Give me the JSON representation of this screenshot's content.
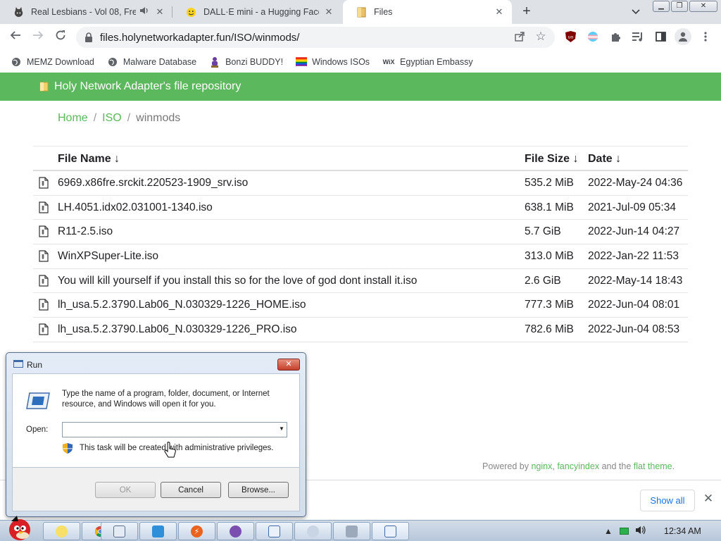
{
  "browser": {
    "tabs": [
      {
        "title": "Real Lesbians - Vol 08, Fre",
        "favicon": "cat-face-icon",
        "audio": true
      },
      {
        "title": "DALL·E mini - a Hugging Face",
        "favicon": "hugging-face-icon"
      },
      {
        "title": "Files",
        "favicon": "folder-icon",
        "active": true
      }
    ],
    "url": "files.holynetworkadapter.fun/ISO/winmods/"
  },
  "bookmarks": [
    {
      "label": "MEMZ Download",
      "icon": "globe-icon"
    },
    {
      "label": "Malware Database",
      "icon": "globe-icon"
    },
    {
      "label": "Bonzi BUDDY!",
      "icon": "bonzi-icon"
    },
    {
      "label": "Windows ISOs",
      "icon": "rainbow-flag-icon"
    },
    {
      "label": "Egyptian Embassy",
      "icon": "wix-icon"
    }
  ],
  "page": {
    "header_title": "Holy Network Adapter's file repository",
    "breadcrumbs": {
      "home": "Home",
      "sep1": "/",
      "iso": "ISO",
      "sep2": "/",
      "current": "winmods"
    },
    "columns": {
      "name": "File Name  ↓",
      "size": "File Size  ↓",
      "date": "Date  ↓"
    },
    "files": [
      {
        "name": "6969.x86fre.srckit.220523-1909_srv.iso",
        "size": "535.2 MiB",
        "date": "2022-May-24 04:36"
      },
      {
        "name": "LH.4051.idx02.031001-1340.iso",
        "size": "638.1 MiB",
        "date": "2021-Jul-09 05:34"
      },
      {
        "name": "R11-2.5.iso",
        "size": "5.7 GiB",
        "date": "2022-Jun-14 04:27"
      },
      {
        "name": "WinXPSuper-Lite.iso",
        "size": "313.0 MiB",
        "date": "2022-Jan-22 11:53"
      },
      {
        "name": "You will kill yourself if you install this so for the love of god dont install it.iso",
        "size": "2.6 GiB",
        "date": "2022-May-14 18:43"
      },
      {
        "name": "lh_usa.5.2.3790.Lab06_N.030329-1226_HOME.iso",
        "size": "777.3 MiB",
        "date": "2022-Jun-04 08:01"
      },
      {
        "name": "lh_usa.5.2.3790.Lab06_N.030329-1226_PRO.iso",
        "size": "782.6 MiB",
        "date": "2022-Jun-04 08:53"
      }
    ],
    "footer": {
      "prefix": "Powered by ",
      "nginx": "nginx",
      "comma": ", ",
      "fancyindex": "fancyindex",
      "and": " and the ",
      "theme": "flat theme",
      "end": "."
    }
  },
  "download_shelf": {
    "show_all": "Show all"
  },
  "run_dialog": {
    "title": "Run",
    "description": "Type the name of a program, folder, document, or Internet resource, and Windows will open it for you.",
    "open_label": "Open:",
    "open_value": "",
    "admin_note": "This task will be created with administrative privileges.",
    "ok": "OK",
    "cancel": "Cancel",
    "browse": "Browse..."
  },
  "taskbar": {
    "clock": "12:34 AM",
    "colors": {
      "page_header": "#5cb85c",
      "link": "#5cb85c"
    }
  }
}
